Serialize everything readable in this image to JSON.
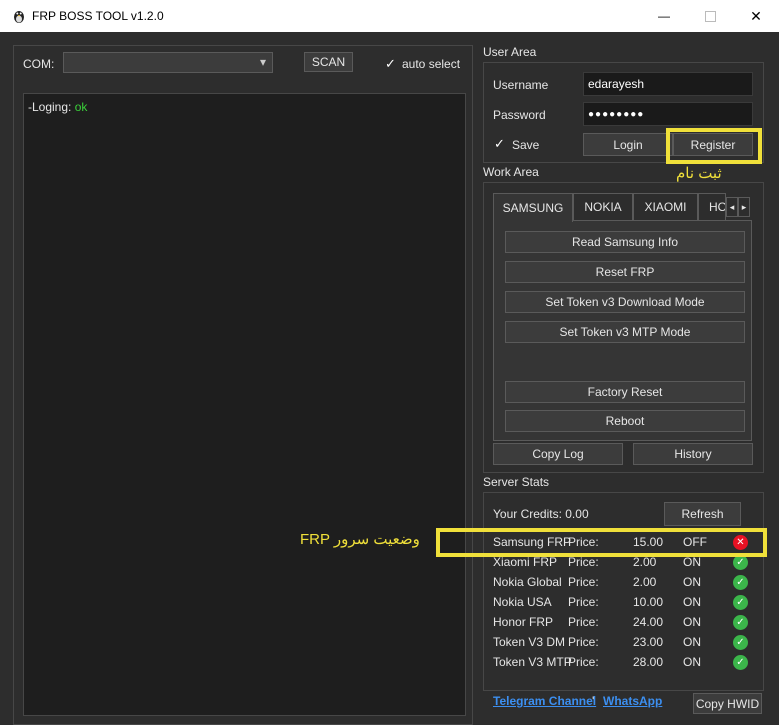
{
  "window": {
    "title": "FRP BOSS TOOL v1.2.0",
    "controls": {
      "minimize": "—",
      "close": "✕"
    }
  },
  "com": {
    "label": "COM:",
    "value": "",
    "scan_label": "SCAN",
    "auto_select_label": "auto select",
    "auto_select_checked": true
  },
  "console": {
    "prefix": "-Loging: ",
    "status": "ok",
    "status_color": "#3ad13a"
  },
  "user_area": {
    "title": "User Area",
    "username_label": "Username",
    "username_value": "edarayesh",
    "password_label": "Password",
    "password_value": "●●●●●●●●",
    "save_label": "Save",
    "save_checked": true,
    "login_label": "Login",
    "register_label": "Register",
    "annotation": "ثبت نام"
  },
  "work_area": {
    "title": "Work Area",
    "tabs": [
      "SAMSUNG",
      "NOKIA",
      "XIAOMI",
      "HO"
    ],
    "actions": [
      "Read Samsung Info",
      "Reset FRP",
      "Set Token v3 Download Mode",
      "Set Token v3 MTP Mode",
      "Factory Reset",
      "Reboot"
    ],
    "copy_log_label": "Copy Log",
    "history_label": "History"
  },
  "server_stats": {
    "title": "Server Stats",
    "credits_label": "Your Credits: 0.00",
    "refresh_label": "Refresh",
    "annotation": "FRP وضعیت سرور",
    "rows": [
      {
        "name": "Samsung FRP",
        "price_label": "Price:",
        "price": "15.00",
        "status": "OFF",
        "ok": false
      },
      {
        "name": "Xiaomi FRP",
        "price_label": "Price:",
        "price": "2.00",
        "status": "ON",
        "ok": true
      },
      {
        "name": "Nokia Global",
        "price_label": "Price:",
        "price": "2.00",
        "status": "ON",
        "ok": true
      },
      {
        "name": "Nokia USA",
        "price_label": "Price:",
        "price": "10.00",
        "status": "ON",
        "ok": true
      },
      {
        "name": "Honor FRP",
        "price_label": "Price:",
        "price": "24.00",
        "status": "ON",
        "ok": true
      },
      {
        "name": "Token V3 DM",
        "price_label": "Price:",
        "price": "23.00",
        "status": "ON",
        "ok": true
      },
      {
        "name": "Token V3 MTP",
        "price_label": "Price:",
        "price": "28.00",
        "status": "ON",
        "ok": true
      }
    ]
  },
  "footer": {
    "telegram_label": "Telegram Channel",
    "separator": "'",
    "whatsapp_label": "WhatsApp",
    "copy_hwid_label": "Copy HWID"
  },
  "icons": {
    "check": "✓",
    "cross": "✕",
    "tab_left": "◂",
    "tab_right": "▸",
    "dropdown": "▾"
  },
  "colors": {
    "highlight": "#f0e03a",
    "ok_green": "#3bb54a",
    "error_red": "#e81123",
    "link_blue": "#3c8ff0"
  }
}
